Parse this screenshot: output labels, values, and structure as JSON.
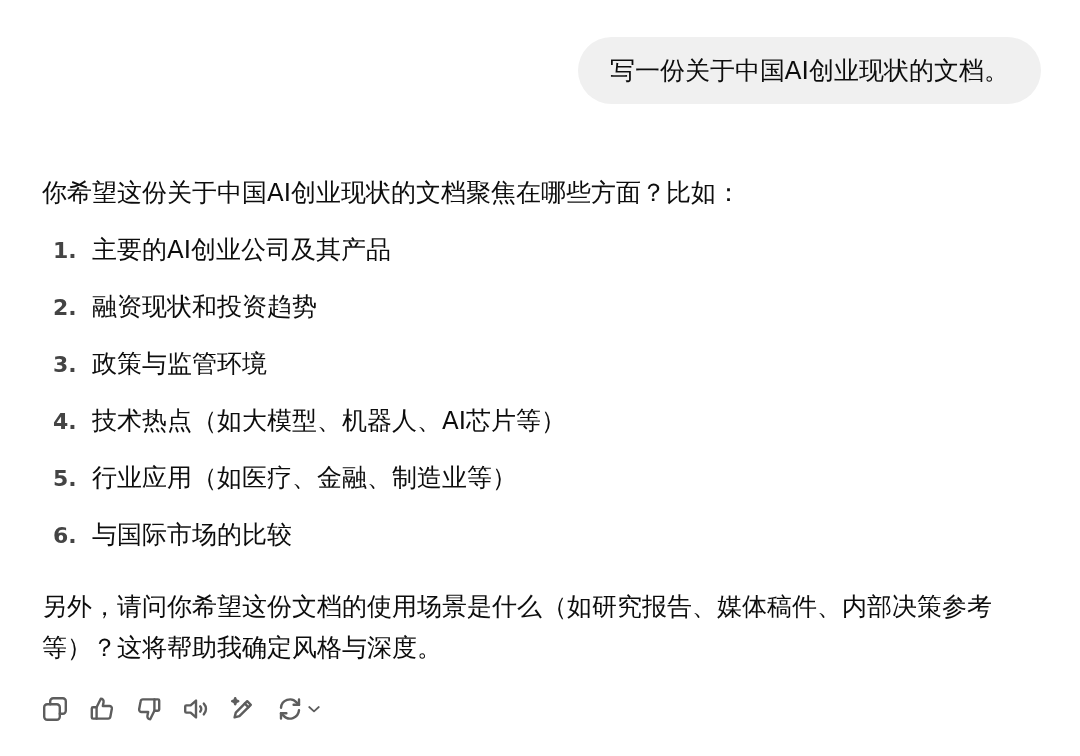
{
  "user_message": {
    "text": "写一份关于中国AI创业现状的文档。"
  },
  "assistant_message": {
    "intro": "你希望这份关于中国AI创业现状的文档聚焦在哪些方面？比如：",
    "options": [
      {
        "number": "1.",
        "text": "主要的AI创业公司及其产品"
      },
      {
        "number": "2.",
        "text": "融资现状和投资趋势"
      },
      {
        "number": "3.",
        "text": "政策与监管环境"
      },
      {
        "number": "4.",
        "text": "技术热点（如大模型、机器人、AI芯片等）"
      },
      {
        "number": "5.",
        "text": "行业应用（如医疗、金融、制造业等）"
      },
      {
        "number": "6.",
        "text": "与国际市场的比较"
      }
    ],
    "follow_up": "另外，请问你希望这份文档的使用场景是什么（如研究报告、媒体稿件、内部决策参考等）？这将帮助我确定风格与深度。"
  },
  "actions": [
    {
      "kind": "copy"
    },
    {
      "kind": "like"
    },
    {
      "kind": "dislike"
    },
    {
      "kind": "speak"
    },
    {
      "kind": "edit"
    },
    {
      "kind": "regenerate"
    }
  ]
}
